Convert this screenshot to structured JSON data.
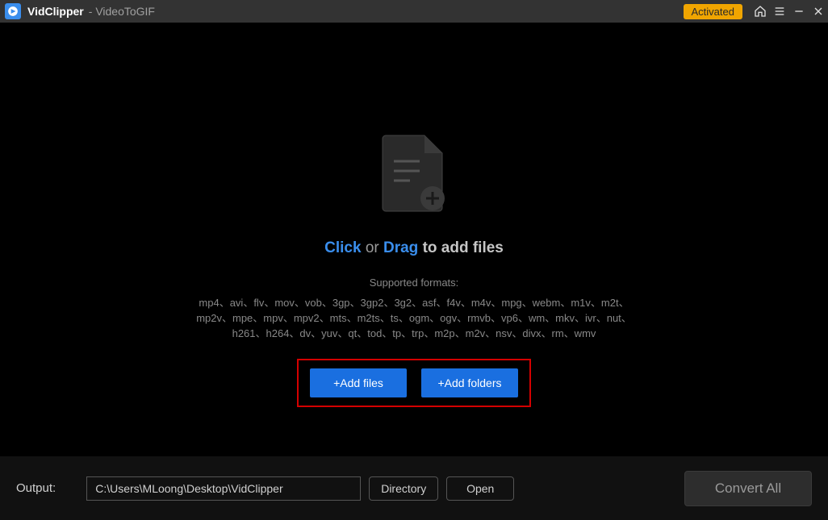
{
  "titlebar": {
    "app_name": "VidClipper",
    "subtitle": "- VideoToGIF",
    "activated_label": "Activated"
  },
  "main": {
    "click_text": "Click",
    "or_text": "or",
    "drag_text": "Drag",
    "rest_text": "to add files",
    "supported_label": "Supported formats:",
    "formats": "mp4、avi、flv、mov、vob、3gp、3gp2、3g2、asf、f4v、m4v、mpg、webm、m1v、m2t、mp2v、mpe、mpv、mpv2、mts、m2ts、ts、ogm、ogv、rmvb、vp6、wm、mkv、ivr、nut、h261、h264、dv、yuv、qt、tod、tp、trp、m2p、m2v、nsv、divx、rm、wmv",
    "add_files_label": "+Add files",
    "add_folders_label": "+Add folders"
  },
  "bottom": {
    "output_label": "Output:",
    "output_path": "C:\\Users\\MLoong\\Desktop\\VidClipper",
    "directory_label": "Directory",
    "open_label": "Open",
    "convert_label": "Convert All"
  }
}
